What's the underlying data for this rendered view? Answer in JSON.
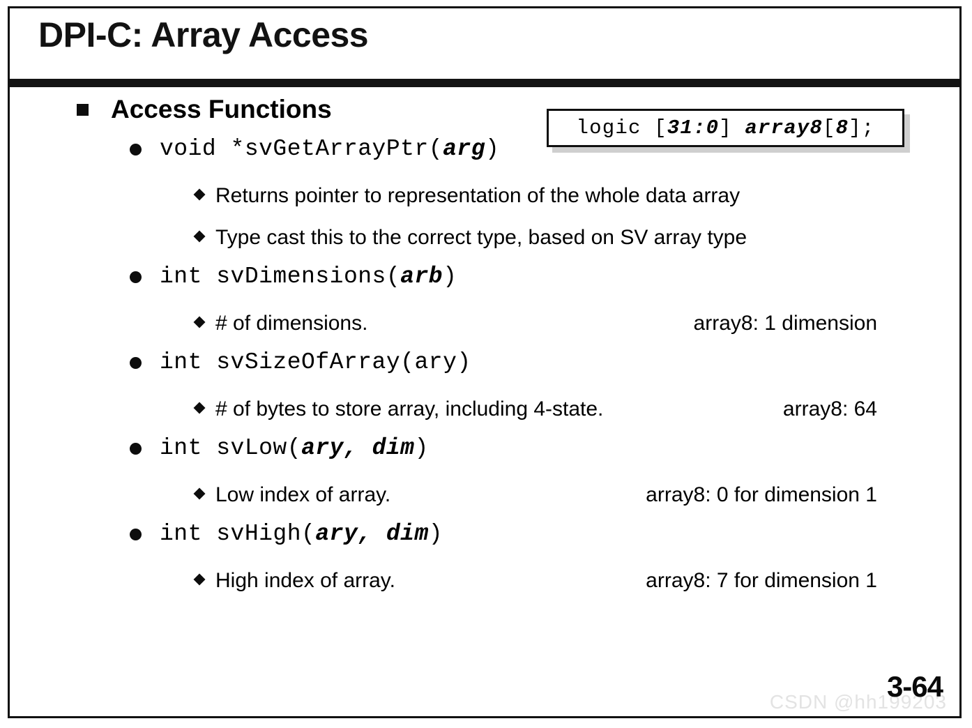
{
  "slide": {
    "title": "DPI-C: Array Access",
    "page_number": "3-64",
    "watermark": "CSDN @hh199203"
  },
  "code_callout": {
    "prefix": "logic [",
    "range": "31:0",
    "mid": "] ",
    "array_name": "array8",
    "open_bracket": "[",
    "size": "8",
    "suffix": "];"
  },
  "heading": {
    "label": "Access Functions"
  },
  "functions": [
    {
      "return_type": "void *",
      "name": "svGetArrayPtr",
      "open": "(",
      "params": "arg",
      "close": ")",
      "details": [
        {
          "text": "Returns pointer to representation of the whole data array",
          "note": ""
        },
        {
          "text": "Type cast this to the correct type, based on SV array type",
          "note": ""
        }
      ]
    },
    {
      "return_type": "int ",
      "name": "svDimensions",
      "open": "(",
      "params": "arb",
      "close": ")",
      "details": [
        {
          "text": "# of dimensions.",
          "note": "array8: 1 dimension"
        }
      ]
    },
    {
      "return_type": "int ",
      "name": "svSizeOfArray",
      "open": "(",
      "params": "ary",
      "close": ")",
      "params_italic": false,
      "details": [
        {
          "text": "# of bytes to store array, including 4-state.",
          "note": "array8: 64"
        }
      ]
    },
    {
      "return_type": "int ",
      "name": "svLow",
      "open": "(",
      "params": "ary, dim",
      "close": ")",
      "details": [
        {
          "text": "Low index of array.",
          "note": "array8: 0 for dimension 1"
        }
      ]
    },
    {
      "return_type": "int ",
      "name": "svHigh",
      "open": "(",
      "params": "ary, dim",
      "close": ")",
      "details": [
        {
          "text": "High index of array.",
          "note": "array8: 7 for dimension 1"
        }
      ]
    }
  ]
}
